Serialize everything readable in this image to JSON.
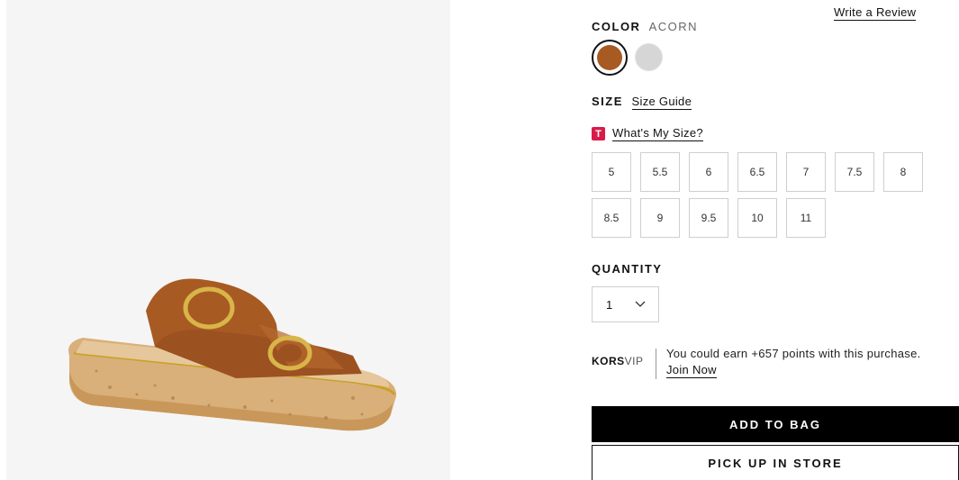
{
  "review": {
    "label": "Write a Review"
  },
  "color": {
    "label": "COLOR",
    "selected": "ACORN",
    "swatches": [
      {
        "name": "Acorn",
        "hex": "#a85a23",
        "selected": true
      },
      {
        "name": "Silver",
        "hex": "#d6d6d6",
        "selected": false
      }
    ]
  },
  "size": {
    "label": "SIZE",
    "guide_label": "Size Guide",
    "whats_my_size_icon": "T",
    "whats_my_size_label": "What's My Size?",
    "options": [
      "5",
      "5.5",
      "6",
      "6.5",
      "7",
      "7.5",
      "8",
      "8.5",
      "9",
      "9.5",
      "10",
      "11"
    ]
  },
  "quantity": {
    "label": "QUANTITY",
    "value": "1"
  },
  "korsvip": {
    "brand_bold": "KORS",
    "brand_light": "VIP",
    "message": "You could earn +657 points with this purchase.",
    "join_label": "Join Now"
  },
  "actions": {
    "add_to_bag": "ADD TO BAG",
    "pickup": "PICK UP IN STORE"
  }
}
